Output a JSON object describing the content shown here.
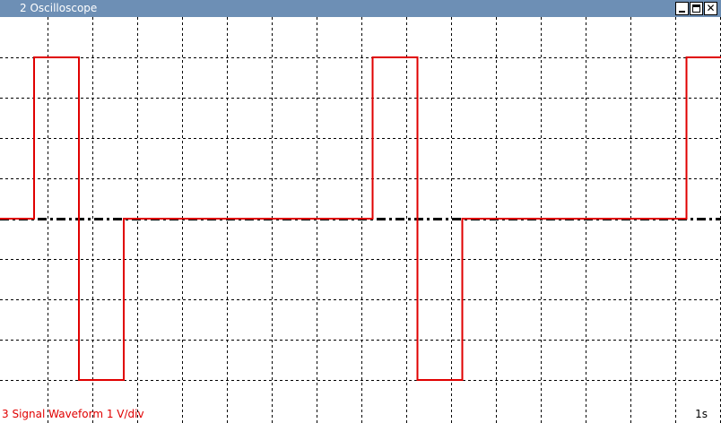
{
  "window": {
    "title": "2 Oscilloscope",
    "buttons": [
      {
        "name": "minimize",
        "icon": "minimize-icon"
      },
      {
        "name": "maximize",
        "icon": "maximize-icon"
      },
      {
        "name": "close",
        "icon": "close-icon",
        "glyph": "✕"
      }
    ]
  },
  "scope": {
    "signal_label": "3 Signal Waveform 1 V/div",
    "time_label": "1s",
    "colors": {
      "trace": "#e00000",
      "grid": "#000000",
      "baseline": "#000000",
      "titlebar": "#6d8fb5",
      "background": "#ffffff"
    },
    "waveform": {
      "levels_div": [
        0,
        4,
        -4,
        0,
        4,
        -4,
        0,
        4
      ],
      "transitions_div": [
        0.7,
        1.7,
        2.7,
        8.25,
        9.25,
        10.25,
        15.25
      ],
      "x_range_div": [
        0,
        16
      ],
      "y_range_div": [
        -4,
        4
      ]
    }
  }
}
